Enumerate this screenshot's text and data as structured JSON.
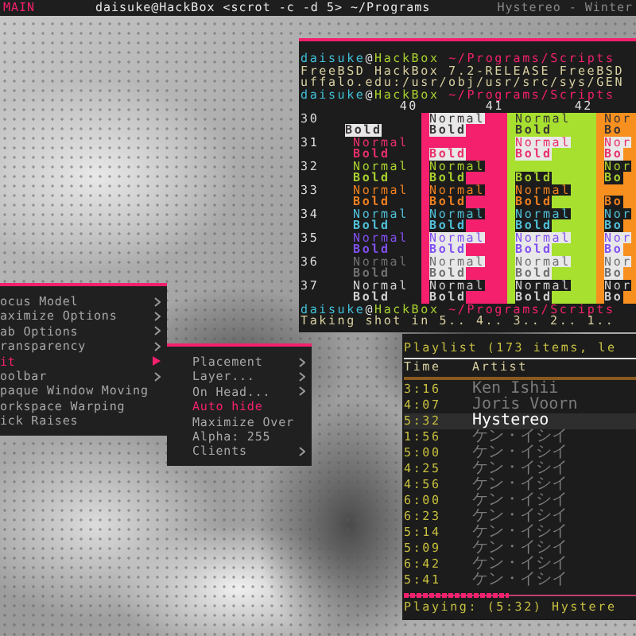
{
  "top_bar": {
    "workspace": "MAIN",
    "title": "daisuke@HackBox <scrot -c -d 5> ~/Programs",
    "right_title": "Hystereo - Winter"
  },
  "terminal": {
    "lines": [
      {
        "kind": "prompt",
        "user": "daisuke",
        "separator": "@",
        "host": "HackBox",
        "path": "~/Programs/Scripts"
      },
      {
        "kind": "output",
        "text": "FreeBSD HackBox 7.2-RELEASE FreeBSD"
      },
      {
        "kind": "output",
        "text": "uffalo.edu:/usr/obj/usr/src/sys/GEN"
      },
      {
        "kind": "prompt",
        "user": "daisuke",
        "separator": "@",
        "host": "HackBox",
        "path": "~/Programs/Scripts"
      }
    ],
    "color_table": {
      "columns": [
        {
          "header": "40",
          "color": "#1c1c1c"
        },
        {
          "header": "41",
          "color": "#f4206e"
        },
        {
          "header": "42",
          "color": "#a8e030"
        },
        {
          "color": "#f89020"
        }
      ],
      "rows": [
        {
          "label": "30",
          "color": "#3a3434",
          "cells": [
            {
              "bold": "Bold"
            },
            {
              "normal": "Normal",
              "bold": "Bold"
            },
            {
              "normal": "Normal",
              "bold": "Bold"
            },
            {
              "normal": "Nor",
              "bold": "Bo"
            }
          ]
        },
        {
          "label": "31",
          "color": "#e8306a",
          "cells": [
            {
              "normal": "Normal",
              "bold": "Bold"
            },
            {
              "bold": "Bold"
            },
            {
              "normal": "Normal",
              "bold": "Bold"
            },
            {
              "normal": "Nor",
              "bold": "Bo"
            }
          ]
        },
        {
          "label": "32",
          "color": "#a8d030",
          "cells": [
            {
              "normal": "Normal",
              "bold": "Bold"
            },
            {
              "normal": "Normal",
              "bold": "Bold"
            },
            {
              "bold": "Bold"
            },
            {
              "normal": "Nor",
              "bold": "Bo"
            }
          ]
        },
        {
          "label": "33",
          "color": "#f08020",
          "cells": [
            {
              "normal": "Normal",
              "bold": "Bold"
            },
            {
              "normal": "Normal",
              "bold": "Bold"
            },
            {
              "normal": "Normal",
              "bold": "Bold"
            },
            {
              "bold": "Bo"
            }
          ]
        },
        {
          "label": "34",
          "color": "#50c0d8",
          "cells": [
            {
              "normal": "Normal",
              "bold": "Bold"
            },
            {
              "normal": "Normal",
              "bold": "Bold"
            },
            {
              "normal": "Normal",
              "bold": "Bold"
            },
            {
              "normal": "Nor",
              "bold": "Bo"
            }
          ]
        },
        {
          "label": "35",
          "color": "#8050f0",
          "cells": [
            {
              "normal": "Normal",
              "bold": "Bold"
            },
            {
              "normal": "Normal",
              "bold": "Bold"
            },
            {
              "normal": "Normal",
              "bold": "Bold"
            },
            {
              "normal": "Nor",
              "bold": "Bo"
            }
          ]
        },
        {
          "label": "36",
          "color": "#707070",
          "cells": [
            {
              "normal": "Normal",
              "bold": "Bold"
            },
            {
              "normal": "Normal",
              "bold": "Bold"
            },
            {
              "normal": "Normal",
              "bold": "Bold"
            },
            {
              "normal": "Nor",
              "bold": "Bo"
            }
          ]
        },
        {
          "label": "37",
          "color": "#d0d0d0",
          "cells": [
            {
              "normal": "Normal",
              "bold": "Bold"
            },
            {
              "normal": "Normal",
              "bold": "Bold"
            },
            {
              "normal": "Normal",
              "bold": "Bold"
            },
            {
              "normal": "Nor",
              "bold": "Bo"
            }
          ]
        }
      ]
    },
    "after_lines": [
      {
        "kind": "prompt",
        "user": "daisuke",
        "separator": "@",
        "host": "HackBox",
        "path": "~/Programs/Scripts"
      },
      {
        "kind": "output",
        "text": "Taking shot in 5.. 4.. 3.. 2.. 1.."
      }
    ]
  },
  "root_menu": {
    "items": [
      {
        "label": "ocus Model",
        "has_submenu": true,
        "selected": false
      },
      {
        "label": "aximize Options",
        "has_submenu": true,
        "selected": false
      },
      {
        "label": "ab Options",
        "has_submenu": true,
        "selected": false
      },
      {
        "label": "ransparency",
        "has_submenu": true,
        "selected": false
      },
      {
        "label": "it",
        "has_submenu": true,
        "selected": true
      },
      {
        "label": "oolbar",
        "has_submenu": true,
        "selected": false
      },
      {
        "label": "paque Window Moving",
        "has_submenu": false,
        "selected": false
      },
      {
        "label": "orkspace Warping",
        "has_submenu": false,
        "selected": false
      },
      {
        "label": "ick Raises",
        "has_submenu": false,
        "selected": false
      }
    ]
  },
  "submenu": {
    "items": [
      {
        "label": "Placement",
        "has_submenu": true,
        "checked": false
      },
      {
        "label": "Layer...",
        "has_submenu": true,
        "checked": false
      },
      {
        "label": "On Head...",
        "has_submenu": true,
        "checked": false
      },
      {
        "label": "Auto hide",
        "has_submenu": false,
        "checked": true
      },
      {
        "label": "Maximize Over",
        "has_submenu": false,
        "checked": false
      },
      {
        "label": "Alpha:  255",
        "has_submenu": false,
        "checked": false
      },
      {
        "label": "Clients",
        "has_submenu": true,
        "checked": false
      }
    ]
  },
  "playlist": {
    "title": "Playlist (173 items, le",
    "columns": [
      "Time",
      "Artist"
    ],
    "rows": [
      {
        "time": "3:16",
        "artist": "Ken Ishii",
        "selected": false
      },
      {
        "time": "4:07",
        "artist": "Joris Voorn",
        "selected": false
      },
      {
        "time": "5:32",
        "artist": "Hystereo",
        "selected": true
      },
      {
        "time": "1:56",
        "artist": "ケン・イシイ",
        "selected": false
      },
      {
        "time": "5:00",
        "artist": "ケン・イシイ",
        "selected": false
      },
      {
        "time": "4:25",
        "artist": "ケン・イシイ",
        "selected": false
      },
      {
        "time": "4:56",
        "artist": "ケン・イシイ",
        "selected": false
      },
      {
        "time": "6:00",
        "artist": "ケン・イシイ",
        "selected": false
      },
      {
        "time": "6:23",
        "artist": "ケン・イシイ",
        "selected": false
      },
      {
        "time": "5:14",
        "artist": "ケン・イシイ",
        "selected": false
      },
      {
        "time": "5:09",
        "artist": "ケン・イシイ",
        "selected": false
      },
      {
        "time": "6:42",
        "artist": "ケン・イシイ",
        "selected": false
      },
      {
        "time": "5:41",
        "artist": "ケン・イシイ",
        "selected": false
      }
    ],
    "progress": {
      "level": 0.45
    },
    "status": "Playing: (5:32) Hystere"
  }
}
